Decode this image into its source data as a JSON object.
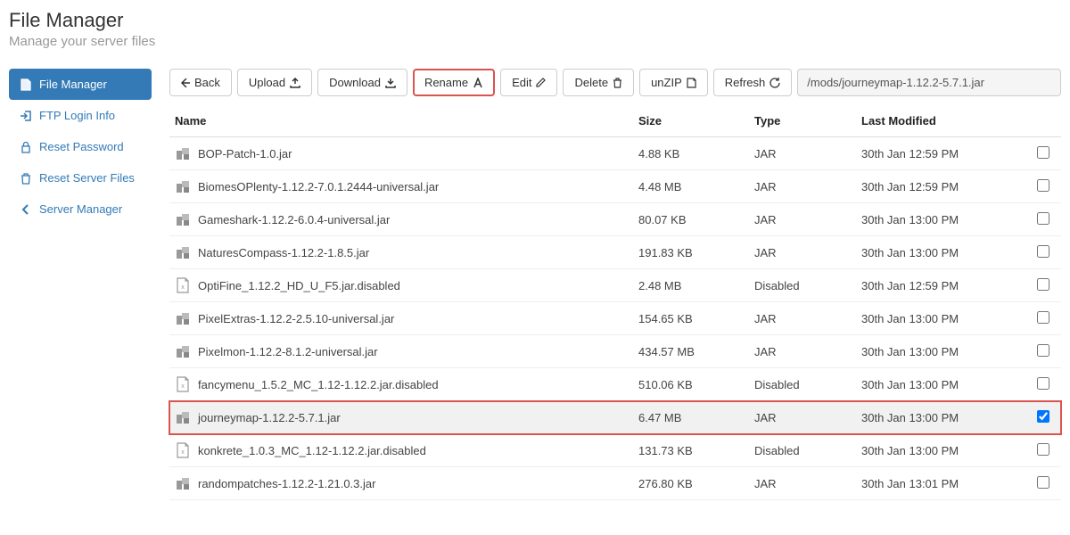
{
  "header": {
    "title": "File Manager",
    "subtitle": "Manage your server files"
  },
  "sidebar": {
    "items": [
      {
        "label": "File Manager",
        "icon": "file-icon",
        "active": true
      },
      {
        "label": "FTP Login Info",
        "icon": "login-icon",
        "active": false
      },
      {
        "label": "Reset Password",
        "icon": "lock-icon",
        "active": false
      },
      {
        "label": "Reset Server Files",
        "icon": "trash-icon",
        "active": false
      },
      {
        "label": "Server Manager",
        "icon": "chevron-left-icon",
        "active": false
      }
    ]
  },
  "toolbar": {
    "back": "Back",
    "upload": "Upload",
    "download": "Download",
    "rename": "Rename",
    "edit": "Edit",
    "delete": "Delete",
    "unzip": "unZIP",
    "refresh": "Refresh",
    "path": "/mods/journeymap-1.12.2-5.7.1.jar"
  },
  "table": {
    "headers": {
      "name": "Name",
      "size": "Size",
      "type": "Type",
      "mod": "Last Modified"
    },
    "rows": [
      {
        "name": "BOP-Patch-1.0.jar",
        "size": "4.88 KB",
        "type": "JAR",
        "mod": "30th Jan 12:59 PM",
        "icon": "jar",
        "checked": false,
        "selected": false
      },
      {
        "name": "BiomesOPlenty-1.12.2-7.0.1.2444-universal.jar",
        "size": "4.48 MB",
        "type": "JAR",
        "mod": "30th Jan 12:59 PM",
        "icon": "jar",
        "checked": false,
        "selected": false
      },
      {
        "name": "Gameshark-1.12.2-6.0.4-universal.jar",
        "size": "80.07 KB",
        "type": "JAR",
        "mod": "30th Jan 13:00 PM",
        "icon": "jar",
        "checked": false,
        "selected": false
      },
      {
        "name": "NaturesCompass-1.12.2-1.8.5.jar",
        "size": "191.83 KB",
        "type": "JAR",
        "mod": "30th Jan 13:00 PM",
        "icon": "jar",
        "checked": false,
        "selected": false
      },
      {
        "name": "OptiFine_1.12.2_HD_U_F5.jar.disabled",
        "size": "2.48 MB",
        "type": "Disabled",
        "mod": "30th Jan 12:59 PM",
        "icon": "disabled",
        "checked": false,
        "selected": false
      },
      {
        "name": "PixelExtras-1.12.2-2.5.10-universal.jar",
        "size": "154.65 KB",
        "type": "JAR",
        "mod": "30th Jan 13:00 PM",
        "icon": "jar",
        "checked": false,
        "selected": false
      },
      {
        "name": "Pixelmon-1.12.2-8.1.2-universal.jar",
        "size": "434.57 MB",
        "type": "JAR",
        "mod": "30th Jan 13:00 PM",
        "icon": "jar",
        "checked": false,
        "selected": false
      },
      {
        "name": "fancymenu_1.5.2_MC_1.12-1.12.2.jar.disabled",
        "size": "510.06 KB",
        "type": "Disabled",
        "mod": "30th Jan 13:00 PM",
        "icon": "disabled",
        "checked": false,
        "selected": false
      },
      {
        "name": "journeymap-1.12.2-5.7.1.jar",
        "size": "6.47 MB",
        "type": "JAR",
        "mod": "30th Jan 13:00 PM",
        "icon": "jar",
        "checked": true,
        "selected": true
      },
      {
        "name": "konkrete_1.0.3_MC_1.12-1.12.2.jar.disabled",
        "size": "131.73 KB",
        "type": "Disabled",
        "mod": "30th Jan 13:00 PM",
        "icon": "disabled",
        "checked": false,
        "selected": false
      },
      {
        "name": "randompatches-1.12.2-1.21.0.3.jar",
        "size": "276.80 KB",
        "type": "JAR",
        "mod": "30th Jan 13:01 PM",
        "icon": "jar",
        "checked": false,
        "selected": false
      }
    ]
  }
}
